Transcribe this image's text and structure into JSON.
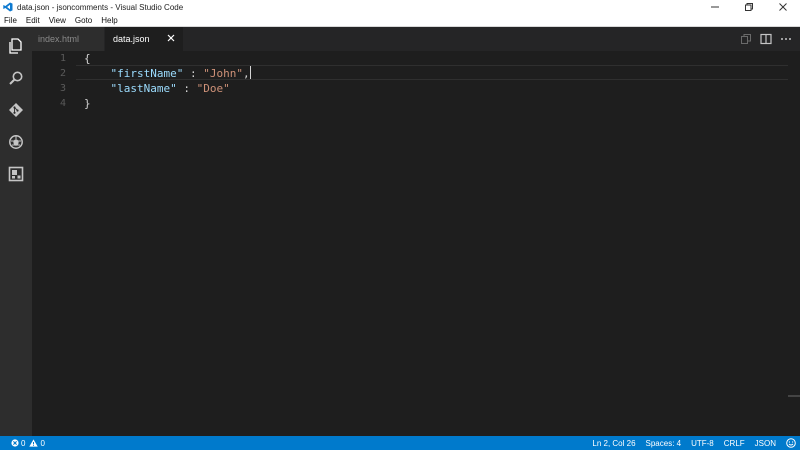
{
  "window": {
    "title": "data.json - jsoncomments - Visual Studio Code"
  },
  "menu": {
    "items": [
      "File",
      "Edit",
      "View",
      "Goto",
      "Help"
    ]
  },
  "activity_bar": {
    "icons": [
      "explorer-icon",
      "search-icon",
      "git-icon",
      "debug-icon",
      "extensions-icon"
    ],
    "active": "explorer-icon"
  },
  "tabs": [
    {
      "label": "index.html",
      "active": false
    },
    {
      "label": "data.json",
      "active": true
    }
  ],
  "editor": {
    "line_numbers": [
      "1",
      "2",
      "3",
      "4"
    ],
    "lines": [
      [
        {
          "t": "{",
          "c": "p"
        }
      ],
      [
        {
          "t": "    ",
          "c": "p"
        },
        {
          "t": "\"firstName\"",
          "c": "k"
        },
        {
          "t": " : ",
          "c": "p"
        },
        {
          "t": "\"John\"",
          "c": "s"
        },
        {
          "t": ",",
          "c": "p"
        }
      ],
      [
        {
          "t": "    ",
          "c": "p"
        },
        {
          "t": "\"lastName\"",
          "c": "k"
        },
        {
          "t": " : ",
          "c": "p"
        },
        {
          "t": "\"Doe\"",
          "c": "s"
        }
      ],
      [
        {
          "t": "}",
          "c": "p"
        }
      ]
    ],
    "cursor_line": 2
  },
  "status": {
    "errors": "0",
    "warnings": "0",
    "position": "Ln 2, Col 26",
    "indent": "Spaces: 4",
    "encoding": "UTF-8",
    "eol": "CRLF",
    "language": "JSON"
  },
  "colors": {
    "accent": "#007acc",
    "editor_bg": "#1e1e1e",
    "key": "#9cdcfe",
    "string": "#ce9178"
  }
}
